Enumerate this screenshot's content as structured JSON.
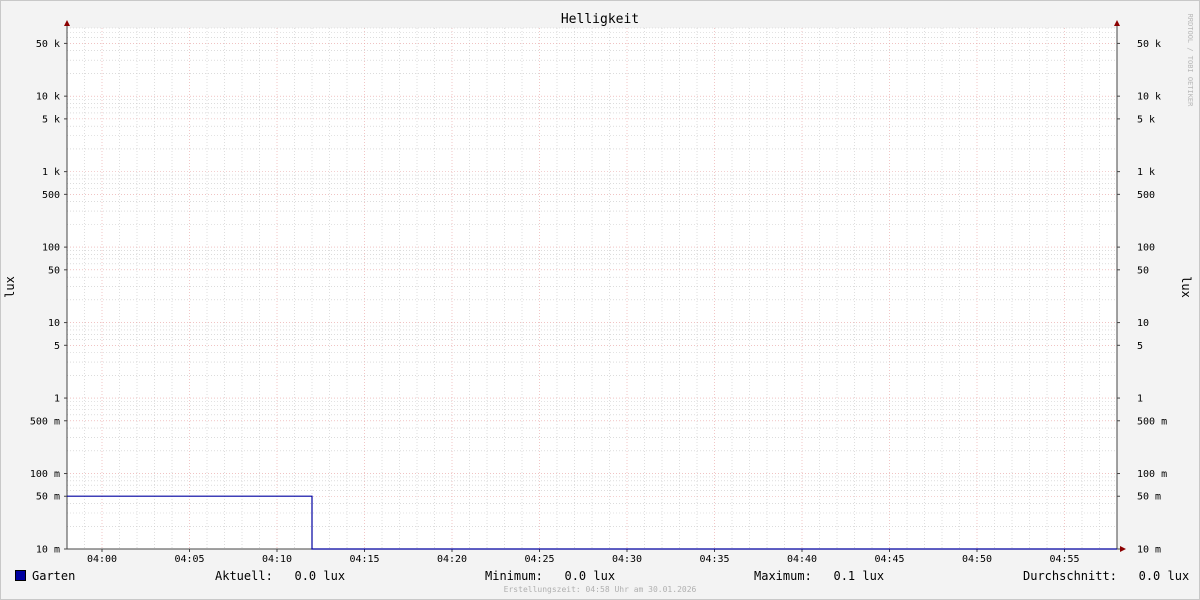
{
  "chart_data": {
    "type": "line",
    "title": "Helligkeit",
    "ylabel": "lux",
    "watermark": "RRDTOOL / TOBI OETIKER",
    "yscale": "log",
    "ylim": [
      0.01,
      80000
    ],
    "xlim": [
      "03:58",
      "04:58"
    ],
    "x_ticks": [
      "04:00",
      "04:05",
      "04:10",
      "04:15",
      "04:20",
      "04:25",
      "04:30",
      "04:35",
      "04:40",
      "04:45",
      "04:50",
      "04:55"
    ],
    "y_ticks": [
      {
        "value": 0.01,
        "label": "10 m"
      },
      {
        "value": 0.05,
        "label": "50 m"
      },
      {
        "value": 0.1,
        "label": "100 m"
      },
      {
        "value": 0.5,
        "label": "500 m"
      },
      {
        "value": 1,
        "label": "1"
      },
      {
        "value": 5,
        "label": "5"
      },
      {
        "value": 10,
        "label": "10"
      },
      {
        "value": 50,
        "label": "50"
      },
      {
        "value": 100,
        "label": "100"
      },
      {
        "value": 500,
        "label": "500"
      },
      {
        "value": 1000,
        "label": "1 k"
      },
      {
        "value": 5000,
        "label": "5 k"
      },
      {
        "value": 10000,
        "label": "10 k"
      },
      {
        "value": 50000,
        "label": "50 k"
      }
    ],
    "grid": true,
    "series": [
      {
        "name": "Garten",
        "color": "#0000a0",
        "points": [
          {
            "x": "03:58",
            "y": 0.05
          },
          {
            "x": "04:12",
            "y": 0.05
          },
          {
            "x": "04:12",
            "y": 0.01
          },
          {
            "x": "04:58",
            "y": 0.01
          }
        ]
      }
    ]
  },
  "legend": {
    "series_name": "Garten",
    "current_label": "Aktuell:",
    "current_value": "0.0 lux",
    "min_label": "Minimum:",
    "min_value": "0.0 lux",
    "max_label": "Maximum:",
    "max_value": "0.1 lux",
    "avg_label": "Durchschnitt:",
    "avg_value": "0.0 lux"
  },
  "footer": "Erstellungszeit: 04:58 Uhr am 30.01.2026",
  "colors": {
    "series": "#0000a0",
    "major_grid": "#e8a0a0",
    "minor_grid": "#c8c8c8",
    "axis": "#444444",
    "arrow": "#8b0000"
  }
}
